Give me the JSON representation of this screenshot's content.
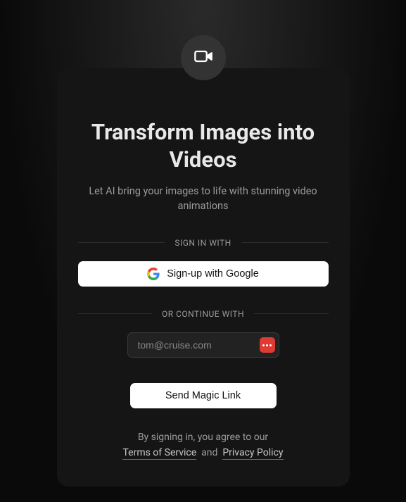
{
  "header": {
    "title": "Transform Images into Videos",
    "subtitle": "Let AI bring your images to life with stunning video animations"
  },
  "auth": {
    "sign_in_with_label": "SIGN IN WITH",
    "google_button": "Sign-up with Google",
    "or_continue_label": "OR CONTINUE WITH",
    "email_placeholder": "tom@cruise.com",
    "magic_link_button": "Send Magic Link"
  },
  "legal": {
    "prefix": "By signing in, you agree to our",
    "terms_label": "Terms of Service",
    "and": "and",
    "privacy_label": "Privacy Policy"
  }
}
